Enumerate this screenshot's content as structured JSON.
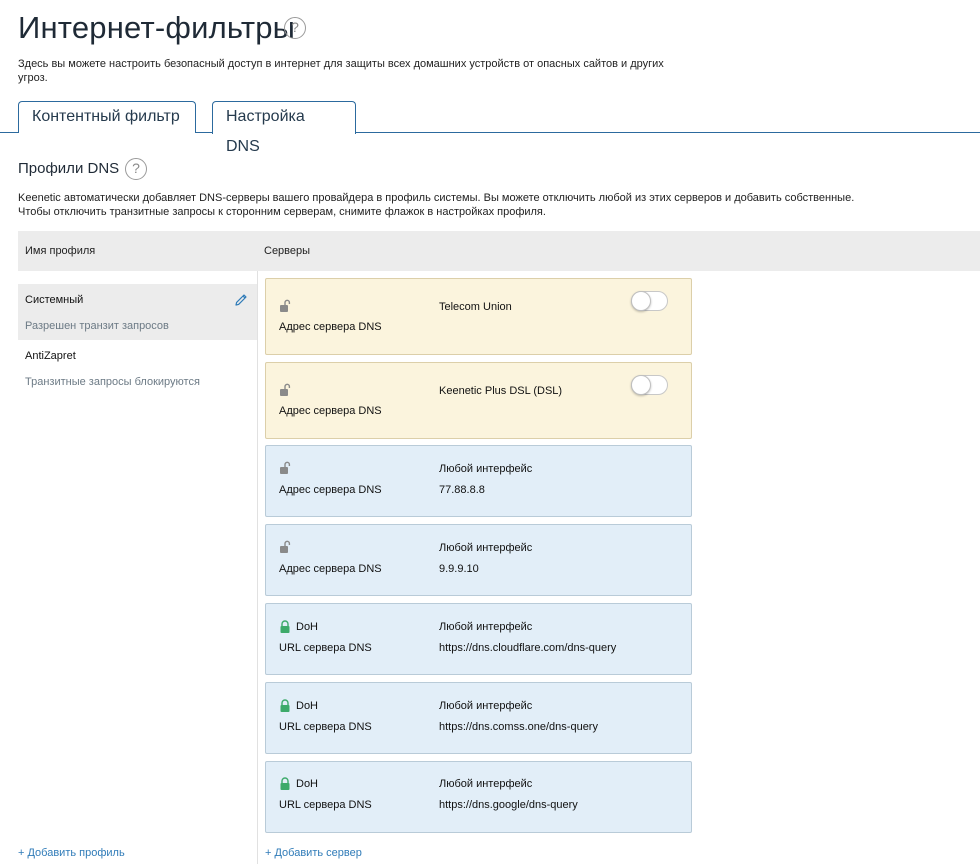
{
  "page": {
    "title": "Интернет-фильтры",
    "intro": "Здесь вы можете настроить безопасный доступ в интернет для защиты всех домашних устройств от опасных сайтов и других угроз."
  },
  "tabs": [
    {
      "label": "Контентный фильтр",
      "active": false
    },
    {
      "label": "Настройка DNS",
      "active": true
    }
  ],
  "section": {
    "title": "Профили DNS",
    "description_line1": "Keenetic автоматически добавляет DNS-серверы вашего провайдера в профиль системы. Вы можете отключить любой из этих серверов и добавить собственные.",
    "description_line2": "Чтобы отключить транзитные запросы к сторонним серверам, снимите флажок в настройках профиля."
  },
  "table": {
    "col_name": "Имя профиля",
    "col_servers": "Серверы"
  },
  "profiles": [
    {
      "name": "Системный",
      "status": "Разрешен транзит запросов",
      "selected": true
    },
    {
      "name": "AntiZapret",
      "status": "Транзитные запросы блокируются",
      "selected": false
    }
  ],
  "servers": [
    {
      "type": "isp",
      "doh": "",
      "label": "Адрес сервера DNS",
      "interface": "Telecom Union",
      "address": "",
      "enabled": false
    },
    {
      "type": "isp",
      "doh": "",
      "label": "Адрес сервера DNS",
      "interface": "Keenetic Plus DSL (DSL)",
      "address": "",
      "enabled": false
    },
    {
      "type": "custom",
      "doh": "",
      "label": "Адрес сервера DNS",
      "interface": "Любой интерфейс",
      "address": "77.88.8.8"
    },
    {
      "type": "custom",
      "doh": "",
      "label": "Адрес сервера DNS",
      "interface": "Любой интерфейс",
      "address": "9.9.9.10"
    },
    {
      "type": "custom",
      "doh": "DoH",
      "label": "URL сервера DNS",
      "interface": "Любой интерфейс",
      "address": "https://dns.cloudflare.com/dns-query"
    },
    {
      "type": "custom",
      "doh": "DoH",
      "label": "URL сервера DNS",
      "interface": "Любой интерфейс",
      "address": "https://dns.comss.one/dns-query"
    },
    {
      "type": "custom",
      "doh": "DoH",
      "label": "URL сервера DNS",
      "interface": "Любой интерфейс",
      "address": "https://dns.google/dns-query"
    }
  ],
  "actions": {
    "add_profile": "+ Добавить профиль",
    "add_server": "+ Добавить сервер"
  },
  "icons": {
    "help": "question-circle-icon",
    "edit": "pencil-icon",
    "lock_open": "unlock-icon",
    "lock_closed": "lock-icon"
  },
  "colors": {
    "accent": "#2c6a9e",
    "link": "#2f7bb8",
    "isp_card": "#fbf4dd",
    "custom_card": "#e2eef8",
    "lock_green": "#3daa6a"
  }
}
